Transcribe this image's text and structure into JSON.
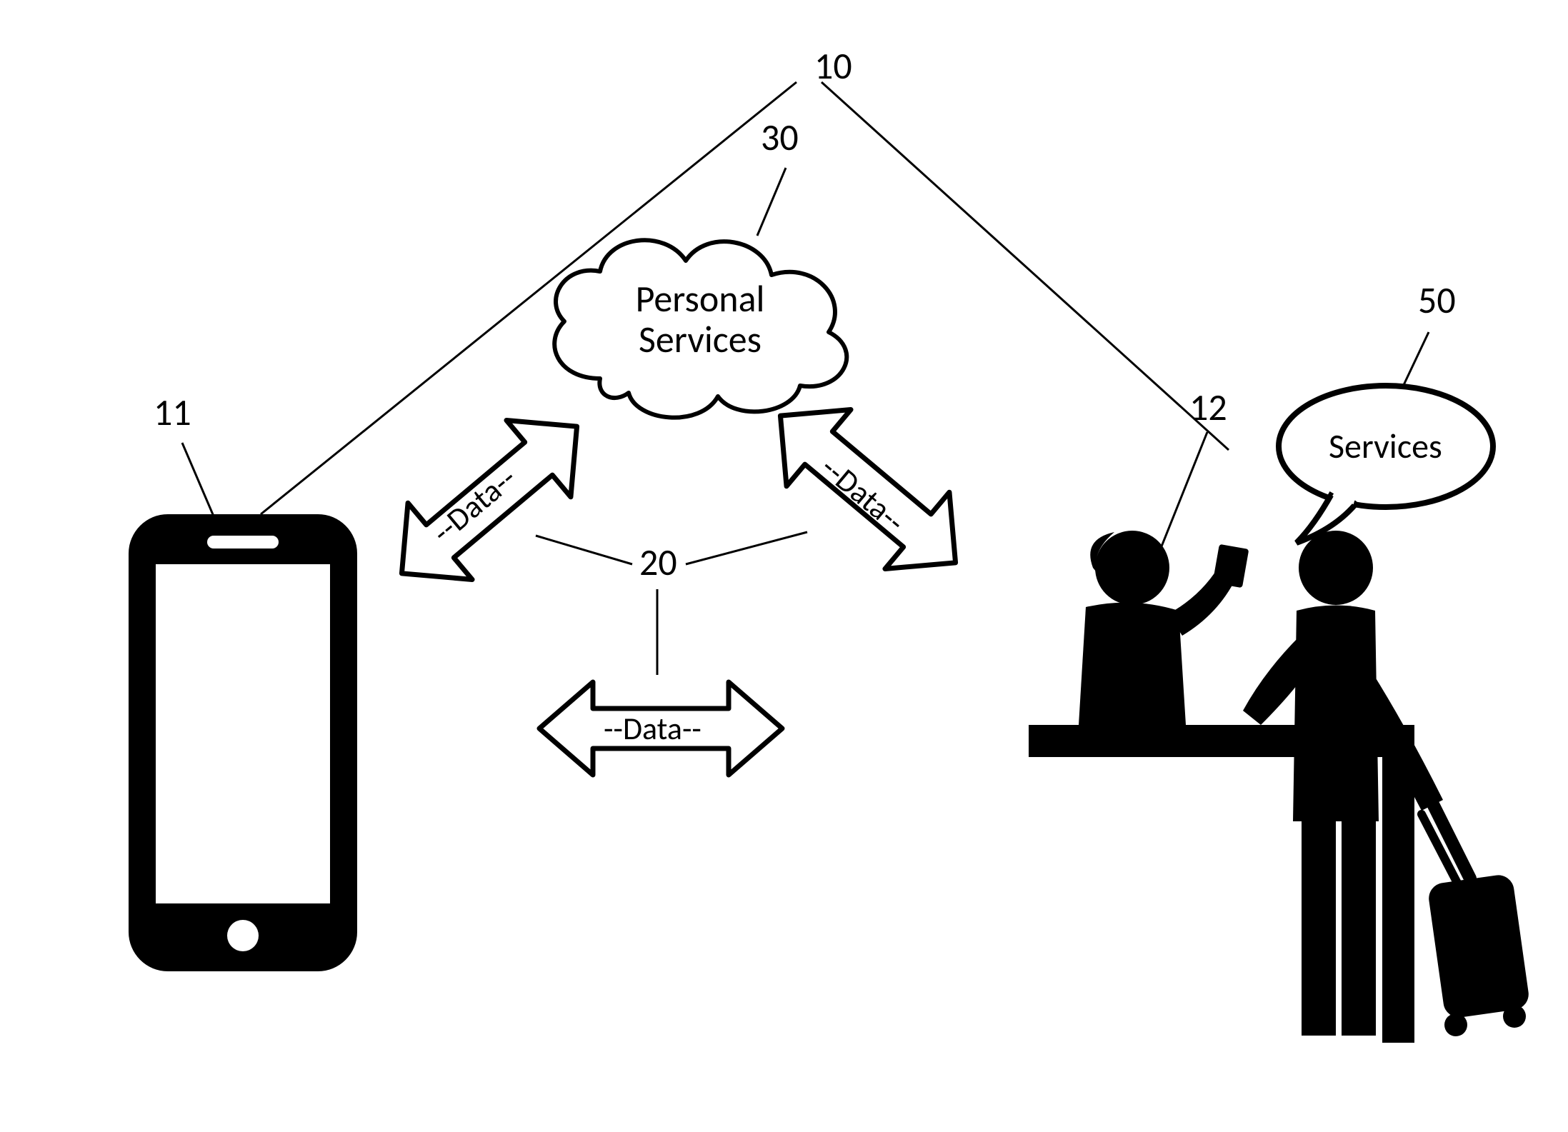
{
  "refs": {
    "system": "10",
    "phone": "11",
    "checkin": "12",
    "data": "20",
    "cloud": "30",
    "services_bubble": "50"
  },
  "labels": {
    "cloud_line1": "Personal",
    "cloud_line2": "Services",
    "data_arrow": "--Data--",
    "speech": "Services"
  }
}
